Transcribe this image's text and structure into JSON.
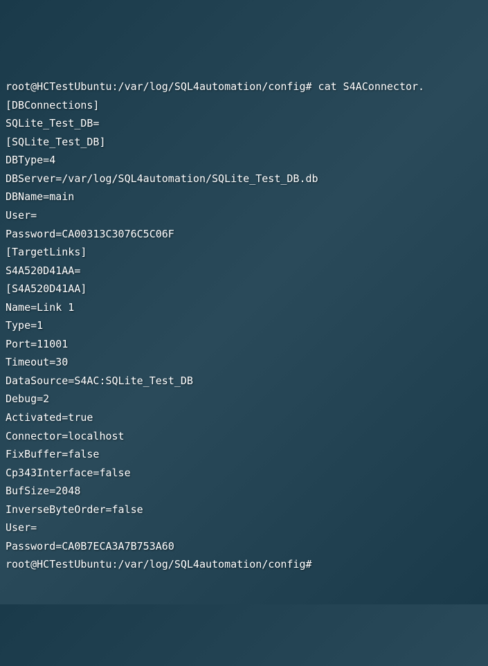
{
  "terminal": {
    "prompt1": "root@HCTestUbuntu:/var/log/SQL4automation/config# cat S4AConnector.",
    "section_dbconnections": "[DBConnections]",
    "sqlite_test_db_key": "SQLite_Test_DB=",
    "blank1": "",
    "section_sqlite": "[SQLite_Test_DB]",
    "dbtype": "DBType=4",
    "dbserver": "DBServer=/var/log/SQL4automation/SQLite_Test_DB.db",
    "dbname": "DBName=main",
    "user1": "User=",
    "password1": "Password=CA00313C3076C5C06F",
    "blank2": "",
    "section_targetlinks": "[TargetLinks]",
    "targetlink_key": "S4A520D41AA=",
    "blank3": "",
    "section_s4a": "[S4A520D41AA]",
    "name": "Name=Link 1",
    "type": "Type=1",
    "port": "Port=11001",
    "timeout": "Timeout=30",
    "datasource": "DataSource=S4AC:SQLite_Test_DB",
    "debug": "Debug=2",
    "activated": "Activated=true",
    "connector": "Connector=localhost",
    "fixbuffer": "FixBuffer=false",
    "cp343": "Cp343Interface=false",
    "bufsize": "BufSize=2048",
    "inversebyte": "InverseByteOrder=false",
    "user2": "User=",
    "password2": "Password=CA0B7ECA3A7B753A60",
    "prompt2": "root@HCTestUbuntu:/var/log/SQL4automation/config#"
  }
}
